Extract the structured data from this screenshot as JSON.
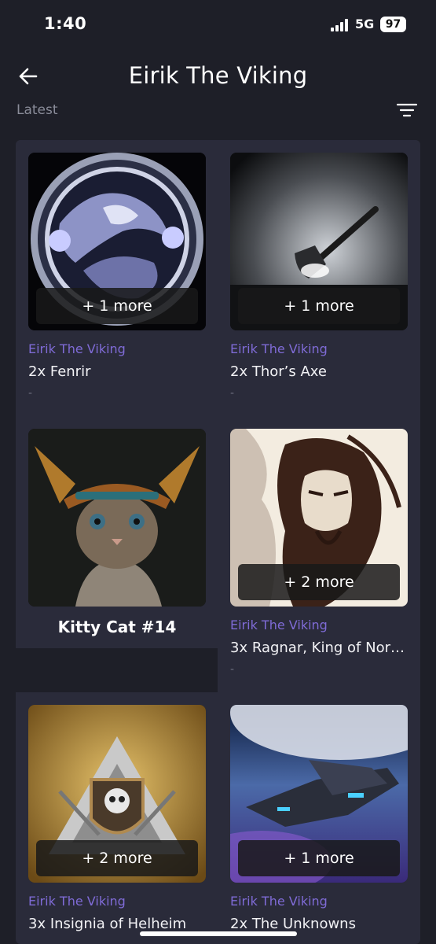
{
  "status": {
    "time": "1:40",
    "network": "5G",
    "battery": "97"
  },
  "header": {
    "title": "Eirik The Viking"
  },
  "sort": {
    "label": "Latest"
  },
  "icons": {
    "back": "arrow-left-icon",
    "filter": "filter-lines-icon"
  },
  "colors": {
    "background": "#1e1f28",
    "panel": "#2a2b3a",
    "creator": "#7f6bd6"
  },
  "cards": [
    {
      "creator": "Eirik The Viking",
      "name": "2x Fenrir",
      "more": "+ 1 more",
      "price": "-"
    },
    {
      "creator": "Eirik The Viking",
      "name": "2x Thor’s Axe",
      "more": "+ 1 more",
      "price": "-"
    },
    {
      "name": "Kitty Cat #14"
    },
    {
      "creator": "Eirik The Viking",
      "name": "3x Ragnar, King of Norw…",
      "more": "+ 2 more",
      "price": "-"
    },
    {
      "creator": "Eirik The Viking",
      "name": "3x Insignia of Helheim",
      "more": "+ 2 more"
    },
    {
      "creator": "Eirik The Viking",
      "name": "2x The Unknowns",
      "more": "+ 1 more"
    }
  ]
}
